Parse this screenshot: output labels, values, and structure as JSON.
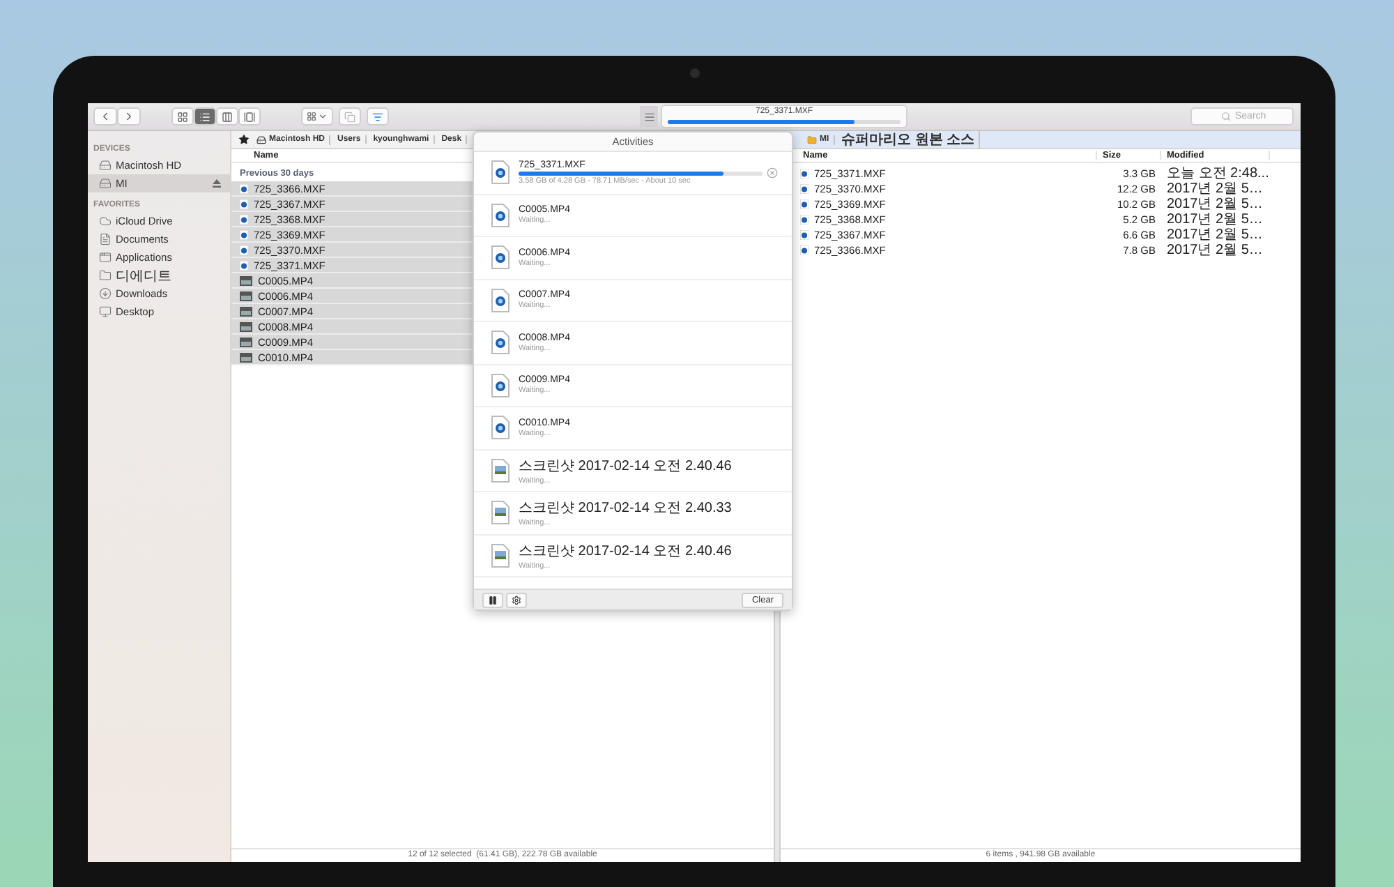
{
  "toolbar": {
    "view_modes": [
      {
        "kind": "icons",
        "selected": false
      },
      {
        "kind": "list",
        "selected": true
      },
      {
        "kind": "columns",
        "selected": false
      },
      {
        "kind": "gallery",
        "selected": false
      }
    ],
    "activity_progress": {
      "file": "725_3371.MXF",
      "level": 0.8
    },
    "search": {
      "placeholder": "Search"
    }
  },
  "sidebar": {
    "sections": [
      {
        "title": "DEVICES",
        "items": [
          {
            "label": "Macintosh HD",
            "kind": "disk",
            "selected": false,
            "eject": false
          },
          {
            "label": "MI",
            "kind": "disk",
            "selected": true,
            "eject": true
          }
        ]
      },
      {
        "title": "FAVORITES",
        "items": [
          {
            "label": "iCloud Drive",
            "kind": "cloud",
            "selected": false,
            "eject": false
          },
          {
            "label": "Documents",
            "kind": "documents",
            "selected": false,
            "eject": false
          },
          {
            "label": "Applications",
            "kind": "applications",
            "selected": false,
            "eject": false
          },
          {
            "label": "디에디트",
            "kind": "folder",
            "selected": false,
            "eject": false
          },
          {
            "label": "Downloads",
            "kind": "downloads",
            "selected": false,
            "eject": false
          },
          {
            "label": "Desktop",
            "kind": "desktop",
            "selected": false,
            "eject": false
          }
        ]
      }
    ]
  },
  "left_pane": {
    "breadcrumb": [
      "Macintosh HD",
      "Users",
      "kyounghwami",
      "Desk"
    ],
    "column": "Name",
    "group": "Previous 30 days",
    "rows": [
      {
        "name": "725_3366.MXF",
        "kind": "mxf",
        "selected": true
      },
      {
        "name": "725_3367.MXF",
        "kind": "mxf",
        "selected": true
      },
      {
        "name": "725_3368.MXF",
        "kind": "mxf",
        "selected": true
      },
      {
        "name": "725_3369.MXF",
        "kind": "mxf",
        "selected": true
      },
      {
        "name": "725_3370.MXF",
        "kind": "mxf",
        "selected": true
      },
      {
        "name": "725_3371.MXF",
        "kind": "mxf",
        "selected": true
      },
      {
        "name": "C0005.MP4",
        "kind": "mp4",
        "selected": true
      },
      {
        "name": "C0006.MP4",
        "kind": "mp4",
        "selected": true
      },
      {
        "name": "C0007.MP4",
        "kind": "mp4",
        "selected": true
      },
      {
        "name": "C0008.MP4",
        "kind": "mp4",
        "selected": true
      },
      {
        "name": "C0009.MP4",
        "kind": "mp4",
        "selected": true
      },
      {
        "name": "C0010.MP4",
        "kind": "mp4",
        "selected": true
      }
    ],
    "status": "12 of 12 selected  (61.41 GB), 222.78 GB available"
  },
  "right_pane": {
    "breadcrumb": [
      "MI",
      "슈퍼마리오 원본 소스"
    ],
    "columns": [
      "Name",
      "Size",
      "Modified"
    ],
    "rows": [
      {
        "name": "725_3371.MXF",
        "size": "3.3 GB",
        "modified": "오늘 오전 2:48..."
      },
      {
        "name": "725_3370.MXF",
        "size": "12.2 GB",
        "modified": "2017년 2월 5…"
      },
      {
        "name": "725_3369.MXF",
        "size": "10.2 GB",
        "modified": "2017년 2월 5…"
      },
      {
        "name": "725_3368.MXF",
        "size": "5.2 GB",
        "modified": "2017년 2월 5…"
      },
      {
        "name": "725_3367.MXF",
        "size": "6.6 GB",
        "modified": "2017년 2월 5…"
      },
      {
        "name": "725_3366.MXF",
        "size": "7.8 GB",
        "modified": "2017년 2월 5…"
      }
    ],
    "status": "6 items , 941.98 GB available"
  },
  "activities": {
    "title": "Activities",
    "items": [
      {
        "name": "725_3371.MXF",
        "kind": "video",
        "status": "3.58 GB of 4.28 GB - 78.71 MB/sec - About 10 sec",
        "level": 0.84
      },
      {
        "name": "C0005.MP4",
        "kind": "video",
        "status": "Waiting..."
      },
      {
        "name": "C0006.MP4",
        "kind": "video",
        "status": "Waiting..."
      },
      {
        "name": "C0007.MP4",
        "kind": "video",
        "status": "Waiting..."
      },
      {
        "name": "C0008.MP4",
        "kind": "video",
        "status": "Waiting..."
      },
      {
        "name": "C0009.MP4",
        "kind": "video",
        "status": "Waiting..."
      },
      {
        "name": "C0010.MP4",
        "kind": "video",
        "status": "Waiting..."
      },
      {
        "name": "스크린샷 2017-02-14 오전 2.40.46",
        "kind": "image",
        "status": "Waiting..."
      },
      {
        "name": "스크린샷 2017-02-14 오전 2.40.33",
        "kind": "image",
        "status": "Waiting..."
      },
      {
        "name": "스크린샷 2017-02-14 오전 2.40.46",
        "kind": "image",
        "status": "Waiting..."
      }
    ],
    "clear": "Clear"
  }
}
